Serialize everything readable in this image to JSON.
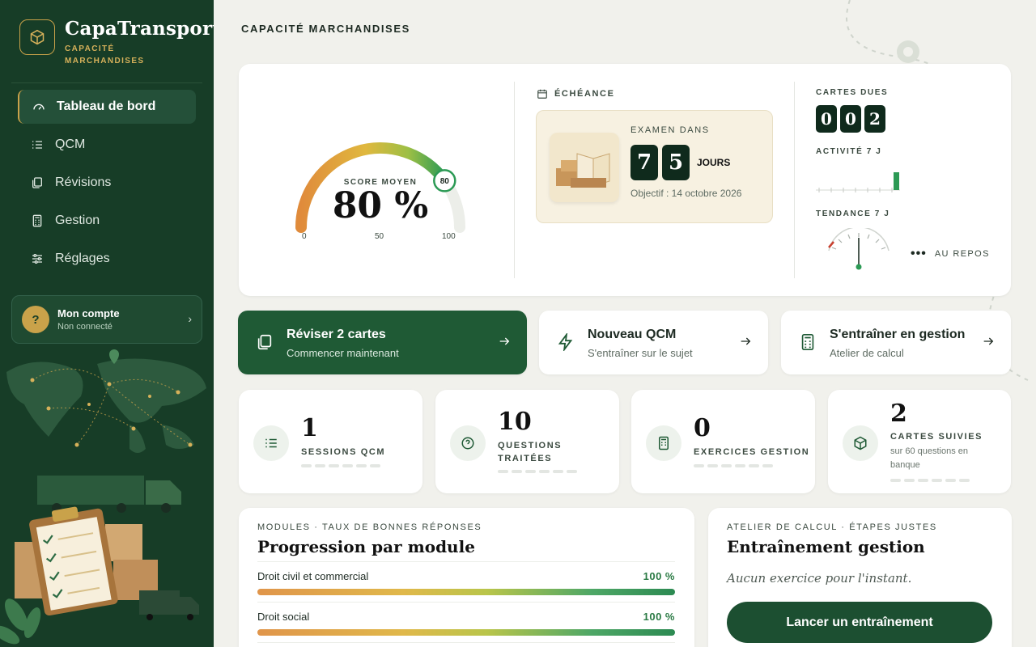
{
  "brand": {
    "name": "CapaTransport",
    "subtitle_line1": "CAPACITÉ",
    "subtitle_line2": "MARCHANDISES",
    "icon": "cube-icon"
  },
  "nav": [
    {
      "label": "Tableau de bord",
      "icon": "dashboard-gauge-icon",
      "active": true
    },
    {
      "label": "QCM",
      "icon": "list-check-icon",
      "active": false
    },
    {
      "label": "Révisions",
      "icon": "cards-icon",
      "active": false
    },
    {
      "label": "Gestion",
      "icon": "calculator-icon",
      "active": false
    },
    {
      "label": "Réglages",
      "icon": "sliders-icon",
      "active": false
    }
  ],
  "account": {
    "avatar": "?",
    "name": "Mon compte",
    "status": "Non connecté"
  },
  "page_title": "CAPACITÉ MARCHANDISES",
  "score": {
    "label": "SCORE MOYEN",
    "value": "80 %",
    "badge": "80",
    "fraction": 0.8,
    "min": "0",
    "mid": "50",
    "max": "100"
  },
  "deadline": {
    "label": "ÉCHÉANCE",
    "exam_label": "EXAMEN DANS",
    "digits": [
      "7",
      "5"
    ],
    "unit": "JOURS",
    "objective": "Objectif : 14 octobre 2026"
  },
  "cards_due": {
    "label": "CARTES DUES",
    "digits": [
      "0",
      "0",
      "2"
    ]
  },
  "activity": {
    "label": "ACTIVITÉ 7 J",
    "values": [
      0,
      0,
      0,
      0,
      0,
      0,
      1
    ]
  },
  "trend": {
    "label": "TENDANCE 7 J",
    "status": "AU REPOS"
  },
  "actions": [
    {
      "title": "Réviser 2 cartes",
      "subtitle": "Commencer maintenant",
      "icon": "cards-icon",
      "primary": true
    },
    {
      "title": "Nouveau QCM",
      "subtitle": "S'entraîner sur le sujet",
      "icon": "lightning-icon",
      "primary": false
    },
    {
      "title": "S'entraîner en gestion",
      "subtitle": "Atelier de calcul",
      "icon": "calculator-icon",
      "primary": false
    }
  ],
  "stats": [
    {
      "value": "1",
      "label_line1": "SESSIONS QCM",
      "label_line2": "",
      "sub": "",
      "icon": "list-icon"
    },
    {
      "value": "10",
      "label_line1": "QUESTIONS",
      "label_line2": "TRAITÉES",
      "sub": "",
      "icon": "question-circle-icon"
    },
    {
      "value": "0",
      "label_line1": "EXERCICES GESTION",
      "label_line2": "",
      "sub": "",
      "icon": "calculator-icon"
    },
    {
      "value": "2",
      "label_line1": "CARTES SUIVIES",
      "label_line2": "",
      "sub": "sur 60 questions en banque",
      "icon": "cube-icon"
    }
  ],
  "modules": {
    "label": "MODULES · TAUX DE BONNES RÉPONSES",
    "title": "Progression par module",
    "items": [
      {
        "name": "Droit civil et commercial",
        "pct": "100 %",
        "fraction": 1.0
      },
      {
        "name": "Droit social",
        "pct": "100 %",
        "fraction": 1.0
      }
    ]
  },
  "calc": {
    "label": "ATELIER DE CALCUL · ÉTAPES JUSTES",
    "title": "Entraînement gestion",
    "empty": "Aucun exercice pour l'instant.",
    "button": "Lancer un entraînement"
  },
  "colors": {
    "brand_green": "#173d27",
    "accent_gold": "#c9a24a",
    "success": "#2a7a44"
  }
}
